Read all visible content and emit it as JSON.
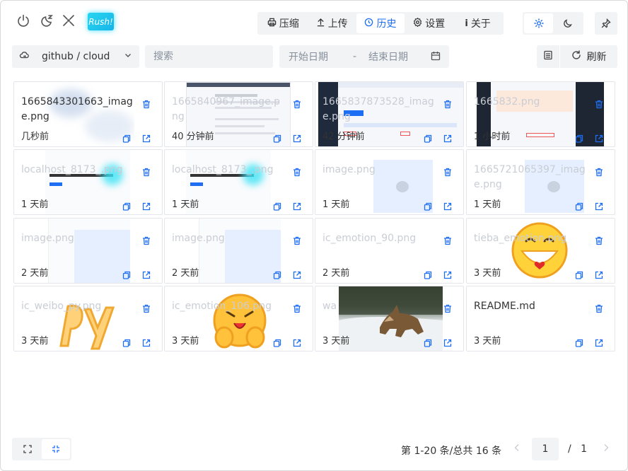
{
  "topbar": {
    "icons": [
      "power-icon",
      "sleep-icon",
      "shrink-icon"
    ],
    "logo_text": "Rush!",
    "nav": [
      {
        "label": "压缩",
        "icon": "printer-icon",
        "active": false
      },
      {
        "label": "上传",
        "icon": "upload-icon",
        "active": false
      },
      {
        "label": "历史",
        "icon": "clock-icon",
        "active": true
      },
      {
        "label": "设置",
        "icon": "gear-icon",
        "active": false
      },
      {
        "label": "关于",
        "icon": "info-icon",
        "active": false
      }
    ],
    "theme": {
      "light_icon": "sun-icon",
      "dark_icon": "moon-icon",
      "selected": "light"
    },
    "pin_icon": "pin-icon"
  },
  "filter": {
    "repo": "github / cloud",
    "search_placeholder": "搜索",
    "date_start_placeholder": "开始日期",
    "date_separator": "-",
    "date_end_placeholder": "结束日期",
    "refresh_label": "刷新"
  },
  "cards": [
    {
      "name": "1665843301663_image.png",
      "time": "几秒前",
      "faded": false
    },
    {
      "name": "1665840967_image.png",
      "time": "40 分钟前",
      "faded": true
    },
    {
      "name": "1665837873528_image.png",
      "time": "42 分钟前",
      "faded": true
    },
    {
      "name": "1665832.png",
      "time": "1 小时前",
      "faded": true
    },
    {
      "name": "localhost_8173_.png",
      "time": "1 天前",
      "faded": true
    },
    {
      "name": "localhost_8173_.png",
      "time": "1 天前",
      "faded": true
    },
    {
      "name": "image.png",
      "time": "1 天前",
      "faded": true
    },
    {
      "name": "1665721065397_image.png",
      "time": "1 天前",
      "faded": true
    },
    {
      "name": "image.png",
      "time": "2 天前",
      "faded": true
    },
    {
      "name": "image.png",
      "time": "2 天前",
      "faded": true
    },
    {
      "name": "ic_emotion_90.png",
      "time": "2 天前",
      "faded": true
    },
    {
      "name": "tieba_emotion.png",
      "time": "3 天前",
      "faded": true
    },
    {
      "name": "ic_weibo_py.png",
      "time": "3 天前",
      "faded": true
    },
    {
      "name": "ic_emotion_106.png",
      "time": "3 天前",
      "faded": true
    },
    {
      "name": "wa",
      "time": "3 天前",
      "faded": true
    },
    {
      "name": "README.md",
      "time": "3 天前",
      "faded": false
    }
  ],
  "pagination": {
    "summary": "第 1-20 条/总共 16 条",
    "current": "1",
    "separator": "/",
    "total": "1"
  },
  "colors": {
    "accent": "#1e6ef4",
    "panel": "#f2f3f5"
  }
}
